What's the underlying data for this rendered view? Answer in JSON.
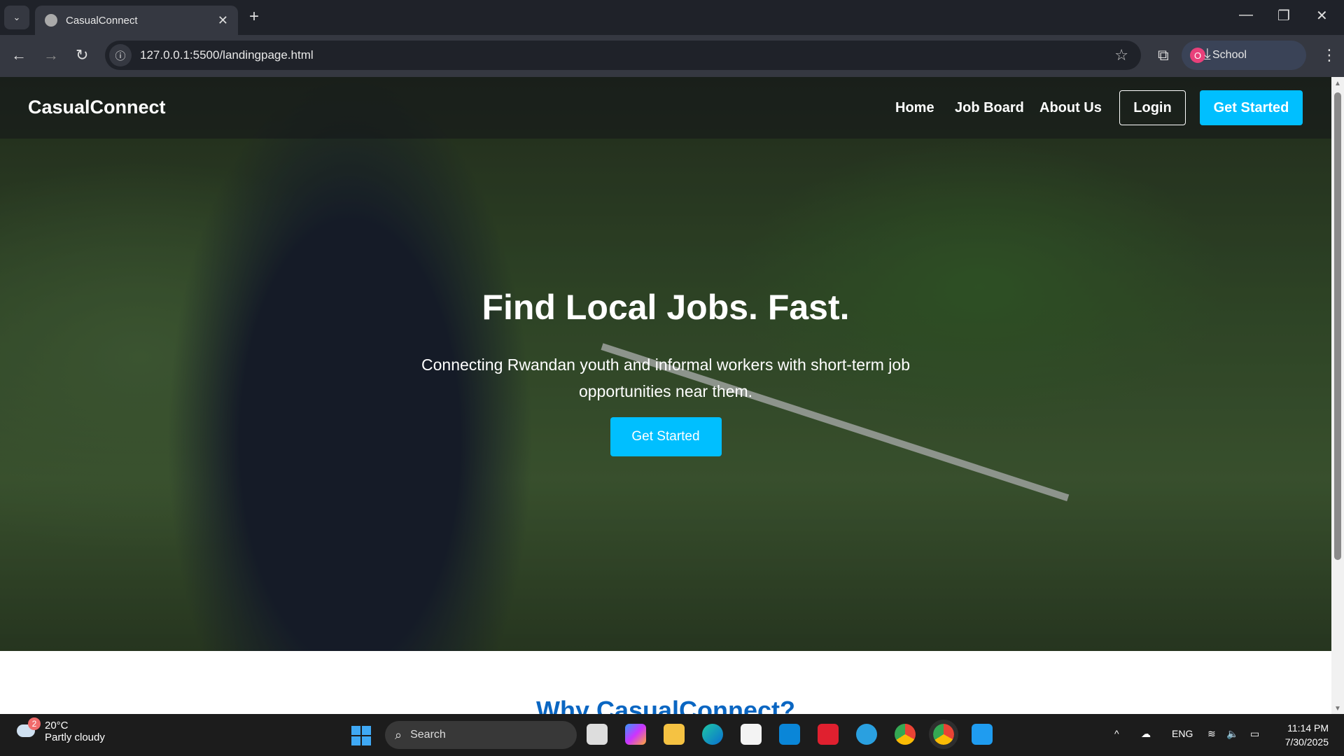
{
  "browser": {
    "tab_title": "CasualConnect",
    "url": "127.0.0.1:5500/landingpage.html",
    "profile_initial": "O",
    "profile_name": "School"
  },
  "nav": {
    "brand": "CasualConnect",
    "links": [
      "Home",
      "Job Board",
      "About Us"
    ],
    "login": "Login",
    "get_started": "Get Started"
  },
  "hero": {
    "title": "Find Local Jobs. Fast.",
    "subtitle": "Connecting Rwandan youth and informal workers with short-term job opportunities near them.",
    "cta": "Get Started"
  },
  "section": {
    "heading": "Why CasualConnect?"
  },
  "taskbar": {
    "weather_badge": "2",
    "temperature": "20°C",
    "condition": "Partly cloudy",
    "search": "Search",
    "language": "ENG",
    "time": "11:14 PM",
    "date": "7/30/2025"
  },
  "colors": {
    "accent": "#00bfff",
    "heading": "#0a66c2"
  }
}
